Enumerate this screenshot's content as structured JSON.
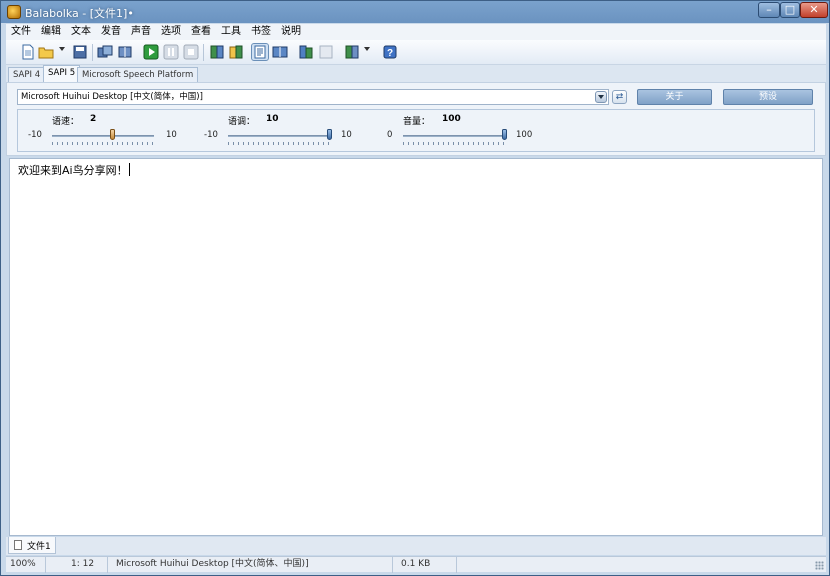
{
  "window": {
    "title": "Balabolka - [文件1]•"
  },
  "menu": [
    "文件",
    "编辑",
    "文本",
    "发音",
    "声音",
    "选项",
    "查看",
    "工具",
    "书签",
    "说明"
  ],
  "toolbar": {
    "icons": [
      "new-file-icon",
      "open-folder-icon",
      "save-icon",
      "save-audio-icon",
      "split-file-icon",
      "play-icon",
      "pause-icon",
      "stop-icon",
      "speak-clipboard-icon",
      "speak-clipboard-2-icon",
      "text-format-icon",
      "dictionary-icon",
      "convert-icon",
      "batch-icon",
      "book-icon",
      "help-icon"
    ]
  },
  "api_tabs": [
    "SAPI 4",
    "SAPI 5",
    "Microsoft Speech Platform"
  ],
  "active_api_tab": "SAPI 5",
  "voice": {
    "selected": "Microsoft Huihui Desktop [中文(简体，中国)]",
    "about_label": "关于",
    "preset_label": "预设"
  },
  "params": {
    "rate": {
      "label": "语速：",
      "value": "2",
      "min": "-10",
      "max": "10",
      "level": 0.6
    },
    "pitch": {
      "label": "语调：",
      "value": "10",
      "min": "-10",
      "max": "10",
      "level": 1.0
    },
    "volume": {
      "label": "音量：",
      "value": "100",
      "min": "0",
      "max": "100",
      "level": 1.0
    }
  },
  "editor": {
    "text": "欢迎来到Ai鸟分享网！"
  },
  "doc_tab": "文件1",
  "status": {
    "zoom": "100%",
    "position": "1:  12",
    "voice": "Microsoft Huihui Desktop [中文(简体、中国)]",
    "size": "0.1 KB"
  }
}
